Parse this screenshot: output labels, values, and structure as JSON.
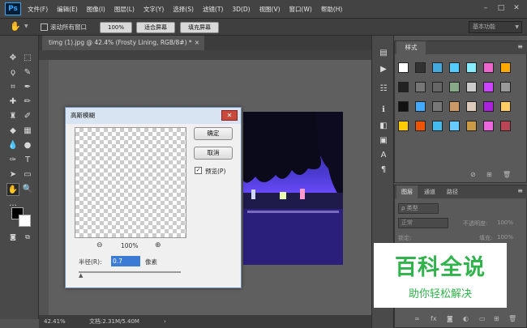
{
  "app": {
    "logo": "Ps"
  },
  "menu": [
    "文件(F)",
    "编辑(E)",
    "图像(I)",
    "图层(L)",
    "文字(Y)",
    "选择(S)",
    "滤镜(T)",
    "3D(D)",
    "视图(V)",
    "窗口(W)",
    "帮助(H)"
  ],
  "options": {
    "scroll_all_windows": "滚动所有窗口",
    "zoom_value": "100%",
    "fit_screen": "适合屏幕",
    "fill_screen": "填充屏幕",
    "workspace": "基本功能"
  },
  "document": {
    "tab_title": "timg (1).jpg @ 42.4% (Frosty Lining, RGB/8#) *",
    "close": "×"
  },
  "status": {
    "zoom": "42.41%",
    "doc_info": "文档:2.31M/5.40M"
  },
  "styles_panel": {
    "tab": "样式"
  },
  "layers_panel": {
    "tabs": [
      "图层",
      "通道",
      "路径"
    ],
    "kind_label": "ρ 类型",
    "blend_mode": "正常",
    "opacity_label": "不透明度:",
    "opacity_value": "100%",
    "lock_label": "锁定:",
    "fill_label": "填充:",
    "fill_value": "100%"
  },
  "dialog": {
    "title": "高斯模糊",
    "ok": "确定",
    "cancel": "取消",
    "preview_label": "预览(P)",
    "preview_checked": true,
    "zoom_value": "100%",
    "radius_label": "半径(R):",
    "radius_value": "0.7",
    "radius_unit": "像素"
  },
  "watermark": {
    "title": "百科全说",
    "subtitle": "助你轻松解决"
  }
}
